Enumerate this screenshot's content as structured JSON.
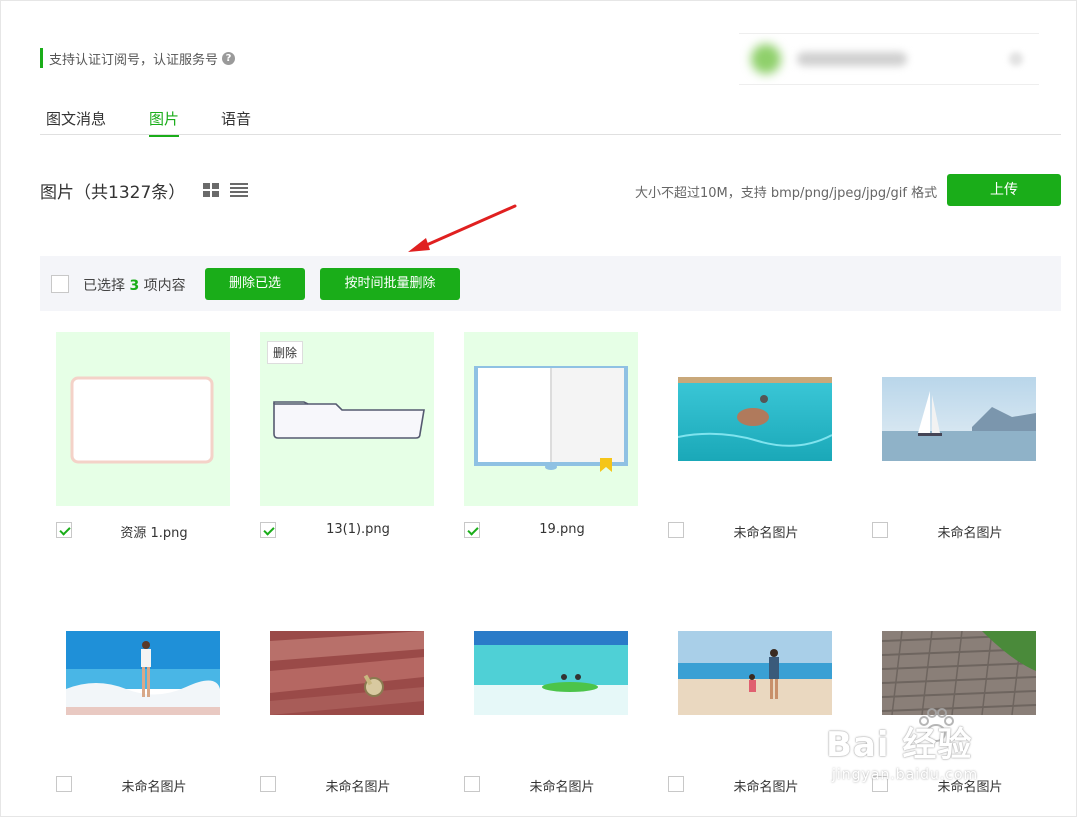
{
  "notice": {
    "text": "支持认证订阅号，认证服务号",
    "help_icon": "?"
  },
  "tabs": [
    {
      "label": "图文消息",
      "active": false
    },
    {
      "label": "图片",
      "active": true
    },
    {
      "label": "语音",
      "active": false
    }
  ],
  "header": {
    "title": "图片（共1327条）",
    "hint": "大小不超过10M，支持 bmp/png/jpeg/jpg/gif 格式",
    "upload_label": "上传"
  },
  "toolbar": {
    "select_prefix": "已选择",
    "selected_count": "3",
    "select_suffix": "项内容",
    "delete_selected_label": "删除已选",
    "batch_delete_label": "按时间批量删除"
  },
  "items": [
    {
      "name": "资源 1.png",
      "checked": true,
      "thumb": "blank-card"
    },
    {
      "name": "13(1).png",
      "checked": true,
      "thumb": "folder",
      "tooltip": "删除"
    },
    {
      "name": "19.png",
      "checked": true,
      "thumb": "open-book"
    },
    {
      "name": "未命名图片",
      "checked": false,
      "thumb": "pig-swimming"
    },
    {
      "name": "未命名图片",
      "checked": false,
      "thumb": "sailboat"
    },
    {
      "name": "未命名图片",
      "checked": false,
      "thumb": "girl-on-beach"
    },
    {
      "name": "未命名图片",
      "checked": false,
      "thumb": "watch-on-bench"
    },
    {
      "name": "未命名图片",
      "checked": false,
      "thumb": "kayak"
    },
    {
      "name": "未命名图片",
      "checked": false,
      "thumb": "father-daughter-beach"
    },
    {
      "name": "未命名图片",
      "checked": false,
      "thumb": "stone-path"
    }
  ],
  "watermark": {
    "main": "Bai 经验",
    "sub": "jingyan.baidu.com"
  },
  "colors": {
    "accent": "#1aad19",
    "thumb_bg": "#e6ffe6",
    "arrow": "#e02020",
    "toolbar_bg": "#f4f5f9"
  }
}
